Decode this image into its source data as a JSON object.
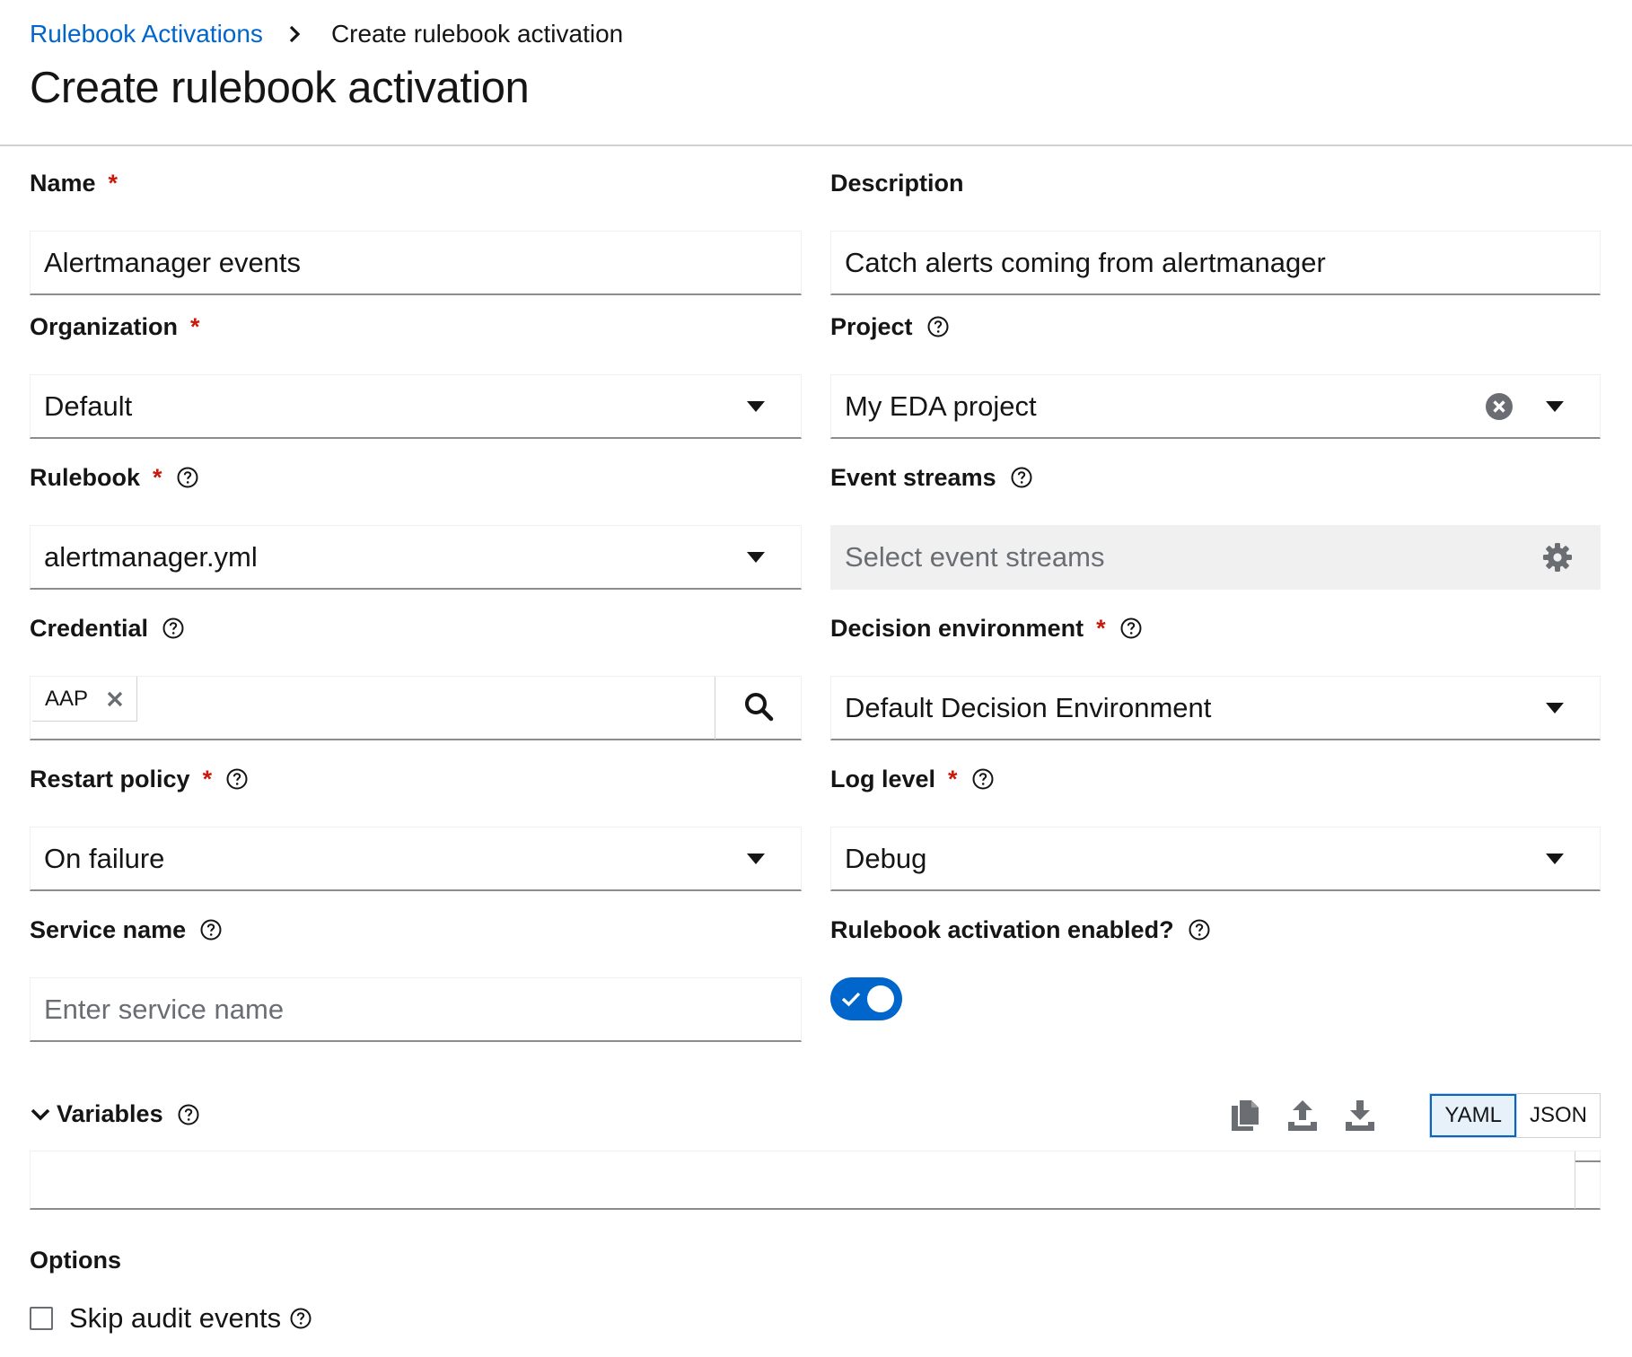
{
  "breadcrumb": {
    "parent": "Rulebook Activations",
    "current": "Create rulebook activation"
  },
  "page_title": "Create rulebook activation",
  "form": {
    "name": {
      "label": "Name",
      "value": "Alertmanager events"
    },
    "description": {
      "label": "Description",
      "value": "Catch alerts coming from alertmanager"
    },
    "organization": {
      "label": "Organization",
      "value": "Default"
    },
    "project": {
      "label": "Project",
      "value": "My EDA project"
    },
    "rulebook": {
      "label": "Rulebook",
      "value": "alertmanager.yml"
    },
    "event_streams": {
      "label": "Event streams",
      "placeholder": "Select event streams"
    },
    "credential": {
      "label": "Credential",
      "chip": "AAP"
    },
    "decision_environment": {
      "label": "Decision environment",
      "value": "Default Decision Environment"
    },
    "restart_policy": {
      "label": "Restart policy",
      "value": "On failure"
    },
    "log_level": {
      "label": "Log level",
      "value": "Debug"
    },
    "service_name": {
      "label": "Service name",
      "placeholder": "Enter service name"
    },
    "enabled": {
      "label": "Rulebook activation enabled?",
      "on": true
    }
  },
  "variables": {
    "label": "Variables",
    "formats": [
      "YAML",
      "JSON"
    ],
    "selected_format": "YAML"
  },
  "options": {
    "label": "Options",
    "skip_audit_events": {
      "label": "Skip audit events",
      "checked": false
    }
  },
  "colors": {
    "link": "#0066cc",
    "required": "#c9190b",
    "toggle_on": "#0066cc",
    "border": "#8a8d90",
    "disabled_bg": "#f0f0f0"
  }
}
